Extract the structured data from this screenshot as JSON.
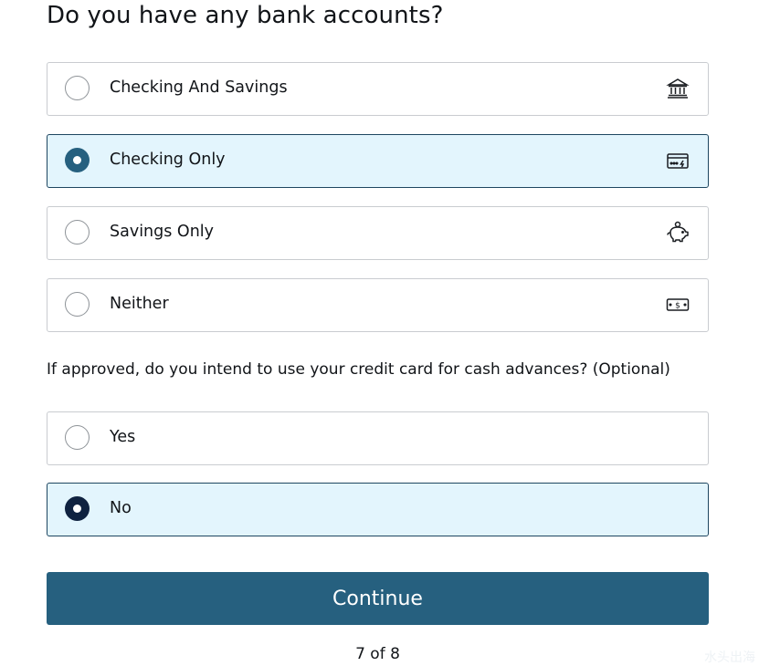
{
  "page_title": "Do you have any bank accounts?",
  "bank_accounts": {
    "options": [
      {
        "label": "Checking And Savings",
        "icon": "bank-icon",
        "selected": false
      },
      {
        "label": "Checking Only",
        "icon": "card-icon",
        "selected": true
      },
      {
        "label": "Savings Only",
        "icon": "piggy-bank-icon",
        "selected": false
      },
      {
        "label": "Neither",
        "icon": "cash-icon",
        "selected": false
      }
    ]
  },
  "cash_advance": {
    "question": "If approved, do you intend to use your credit card for cash advances? (Optional)",
    "options": [
      {
        "label": "Yes",
        "selected": false
      },
      {
        "label": "No",
        "selected": true
      }
    ]
  },
  "continue_label": "Continue",
  "progress": "7 of 8",
  "watermark": "水头出海",
  "colors": {
    "primary_button": "#26607f",
    "selected_bg": "#e3f5fd",
    "selected_border": "#1e4660",
    "radio_bank_selected": "#26607f",
    "radio_advance_selected": "#0f2240"
  }
}
